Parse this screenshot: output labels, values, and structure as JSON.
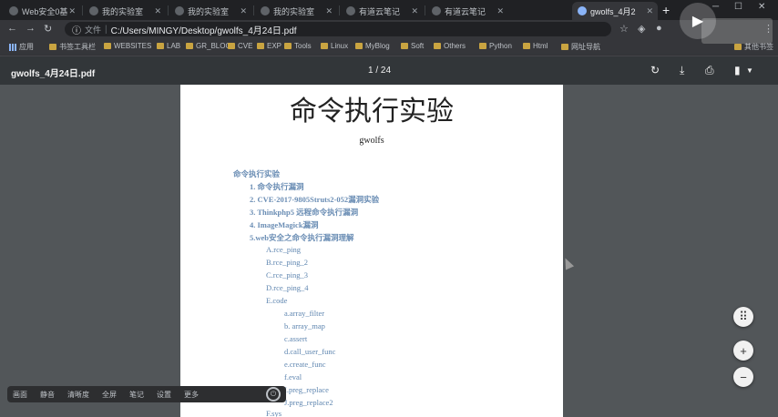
{
  "browser": {
    "tabs": [
      {
        "title": "Web安全0基"
      },
      {
        "title": "我的实验室"
      },
      {
        "title": "我的实验室"
      },
      {
        "title": "我的实验室"
      },
      {
        "title": "有道云笔记"
      },
      {
        "title": "有道云笔记"
      },
      {
        "title": "gwolfs_4月2"
      }
    ],
    "active_tab_index": 6,
    "url_chip": "文件",
    "url": "C:/Users/MINGY/Desktop/gwolfs_4月24日.pdf",
    "bookmarks": [
      "应用",
      "书签工具栏",
      "WEBSITES",
      "LAB",
      "GR_BLOG",
      "CVE",
      "EXP",
      "Tools",
      "Linux",
      "MyBlog",
      "Soft",
      "Others",
      "Python",
      "Html",
      "网址导航"
    ],
    "bookmarks_overflow": "其他书签"
  },
  "pdf": {
    "filename": "gwolfs_4月24日.pdf",
    "page_indicator": "1 / 24",
    "title": "命令执行实验",
    "author": "gwolfs",
    "toc": [
      {
        "text": "命令执行实验",
        "level": 0
      },
      {
        "text": "1. 命令执行漏洞",
        "level": 1
      },
      {
        "text": "2. CVE-2017-9805Struts2-052漏洞实验",
        "level": 1
      },
      {
        "text": "3. Thinkphp5 远程命令执行漏洞",
        "level": 1
      },
      {
        "text": "4. ImageMagick漏洞",
        "level": 1
      },
      {
        "text": "5.web安全之命令执行漏洞理解",
        "level": 1
      },
      {
        "text": "A.rce_ping",
        "level": 2
      },
      {
        "text": "B.rce_ping_2",
        "level": 2
      },
      {
        "text": "C.rce_ping_3",
        "level": 2
      },
      {
        "text": "D.rce_ping_4",
        "level": 2
      },
      {
        "text": "E.code",
        "level": 2
      },
      {
        "text": "a.array_filter",
        "level": 3
      },
      {
        "text": "b. array_map",
        "level": 3
      },
      {
        "text": "c.assert",
        "level": 3
      },
      {
        "text": "d.call_user_func",
        "level": 3
      },
      {
        "text": "e.create_func",
        "level": 3
      },
      {
        "text": "f.eval",
        "level": 3
      },
      {
        "text": "I.preg_replace",
        "level": 3
      },
      {
        "text": "J.preg_replace2",
        "level": 3
      },
      {
        "text": "F.sys",
        "level": 2
      }
    ]
  },
  "zoom": {
    "fit": "⠿",
    "in": "+",
    "out": "−"
  },
  "player_bar": [
    "画面",
    "静音",
    "清晰度",
    "全屏",
    "笔记",
    "设置",
    "更多"
  ]
}
